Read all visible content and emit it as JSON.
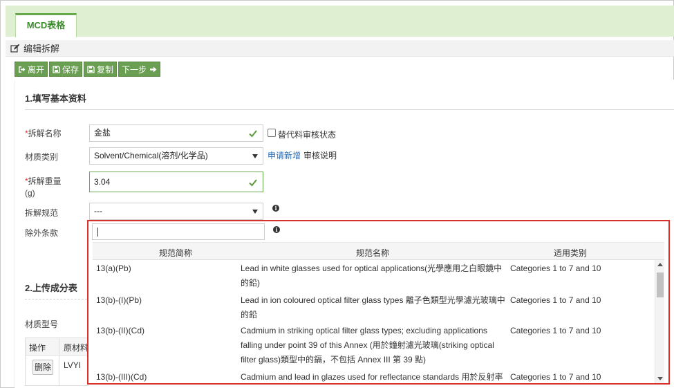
{
  "tab": {
    "label": "MCD表格"
  },
  "section": {
    "title": "编辑拆解"
  },
  "toolbar": {
    "leave": "离开",
    "save": "保存",
    "copy": "复制",
    "next": "下一步"
  },
  "basic": {
    "heading": "1.填写基本资料",
    "name_label": "拆解名称",
    "name_value": "金盐",
    "substitute_label": "替代料审核状态",
    "material_label": "材质类别",
    "material_value": "Solvent/Chemical(溶剂/化学品)",
    "apply_link": "申请新增",
    "audit_note": "审核说明",
    "weight_label": "拆解重量",
    "weight_unit": "(g)",
    "weight_value": "3.04",
    "spec_label": "拆解规范",
    "spec_value": "---",
    "exclusion_label": "除外条款",
    "required_mark": "*"
  },
  "upload": {
    "heading": "2.上传成分表",
    "material_model_label": "材质型号",
    "col_action": "操作",
    "col_material": "原材料",
    "delete_btn": "删除",
    "row_value": "LVYI"
  },
  "popup": {
    "headers": {
      "code": "规范简称",
      "name": "规范名称",
      "category": "适用类别"
    },
    "rows": [
      {
        "code": "13(a)(Pb)",
        "name": "Lead in white glasses used for optical applications(光學應用之白眼鏡中的鉛)",
        "category": "Categories 1 to 7 and 10"
      },
      {
        "code": "13(b)-(I)(Pb)",
        "name": "Lead in ion coloured optical filter glass types 離子色類型光學濾光玻璃中的鉛",
        "category": "Categories 1 to 7 and 10"
      },
      {
        "code": "13(b)-(II)(Cd)",
        "name": "Cadmium in striking optical filter glass types; excluding applications falling under point 39 of this Annex (用於鐘射濾光玻璃(striking optical filter glass)類型中的鎘，不包括 Annex III 第 39 點)",
        "category": "Categories 1 to 7 and 10"
      },
      {
        "code": "13(b)-(III)(Cd)",
        "name": "Cadmium and lead in glazes used for reflectance standards 用於反射率",
        "category": "Categories 1 to 7 and 10"
      }
    ]
  },
  "colors": {
    "accent_green": "#6a9e52",
    "popup_border": "#d9302c",
    "link": "#2a6db5"
  },
  "icons": [
    "edit-icon",
    "exit-icon",
    "save-icon",
    "copy-icon",
    "arrow-right-icon",
    "check-icon",
    "info-icon"
  ]
}
